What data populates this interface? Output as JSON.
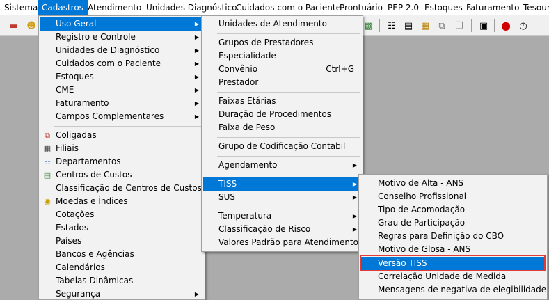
{
  "menubar": {
    "items": [
      "Sistema",
      "Cadastros",
      "Atendimento",
      "Unidades Diagnóstico",
      "Cuidados com o Paciente",
      "Prontuário",
      "PEP 2.0",
      "Estoques",
      "Faturamento",
      "Tesouraria"
    ],
    "active": "Cadastros"
  },
  "toolbar": {
    "icons": [
      "eraser-icon",
      "user-icon",
      "chart-icon",
      "document-tree-icon",
      "document-list-icon",
      "folder-document-icon",
      "copy-icon",
      "monitor-icon",
      "record-icon",
      "clock-icon"
    ]
  },
  "menu1": {
    "items": [
      {
        "label": "Uso Geral",
        "submenu": true,
        "highlighted": true
      },
      {
        "label": "Registro e Controle",
        "submenu": true
      },
      {
        "label": "Unidades de Diagnóstico",
        "submenu": true
      },
      {
        "label": "Cuidados com o Paciente",
        "submenu": true
      },
      {
        "label": "Estoques",
        "submenu": true
      },
      {
        "label": "CME",
        "submenu": true
      },
      {
        "label": "Faturamento",
        "submenu": true
      },
      {
        "label": "Campos Complementares",
        "submenu": true
      },
      {
        "label": "Coligadas",
        "icon": "coligadas-icon"
      },
      {
        "label": "Filiais",
        "icon": "building-icon"
      },
      {
        "label": "Departamentos",
        "icon": "org-chart-icon"
      },
      {
        "label": "Centros de Custos",
        "icon": "cost-center-icon"
      },
      {
        "label": "Classificação de Centros de Custos"
      },
      {
        "label": "Moedas e Índices",
        "icon": "coin-icon"
      },
      {
        "label": "Cotações"
      },
      {
        "label": "Estados"
      },
      {
        "label": "Países"
      },
      {
        "label": "Bancos e Agências"
      },
      {
        "label": "Calendários"
      },
      {
        "label": "Tabelas Dinâmicas"
      },
      {
        "label": "Segurança",
        "submenu": true
      }
    ]
  },
  "menu2": {
    "items": [
      {
        "label": "Unidades de Atendimento"
      },
      {
        "label": "Grupos de Prestadores"
      },
      {
        "label": "Especialidade"
      },
      {
        "label": "Convênio",
        "shortcut": "Ctrl+G"
      },
      {
        "label": "Prestador"
      },
      {
        "label": "Faixas Etárias"
      },
      {
        "label": "Duração de Procedimentos"
      },
      {
        "label": "Faixa de Peso"
      },
      {
        "label": "Grupo de Codificação Contabil"
      },
      {
        "label": "Agendamento",
        "submenu": true
      },
      {
        "label": "TISS",
        "submenu": true,
        "highlighted": true
      },
      {
        "label": "SUS",
        "submenu": true
      },
      {
        "label": "Temperatura",
        "submenu": true
      },
      {
        "label": "Classificação de Risco",
        "submenu": true
      },
      {
        "label": "Valores Padrão para Atendimento"
      }
    ]
  },
  "menu3": {
    "items": [
      {
        "label": "Motivo de Alta - ANS"
      },
      {
        "label": "Conselho Profissional"
      },
      {
        "label": "Tipo de Acomodação"
      },
      {
        "label": "Grau de Participação"
      },
      {
        "label": "Regras para Definição do CBO"
      },
      {
        "label": "Motivo de Glosa - ANS"
      },
      {
        "label": "Versão TISS",
        "highlighted": true
      },
      {
        "label": "Correlação Unidade de Medida"
      },
      {
        "label": "Mensagens de negativa de elegibilidade"
      }
    ]
  }
}
